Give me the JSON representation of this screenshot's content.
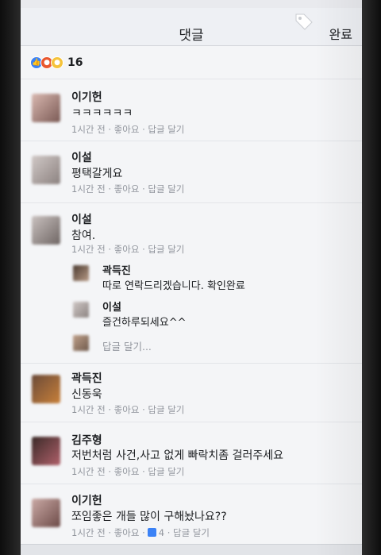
{
  "header": {
    "title": "댓글",
    "done_label": "완료"
  },
  "reactions": {
    "count": "16"
  },
  "comments": [
    {
      "name": "이기헌",
      "text": "ㅋㅋㅋㅋㅋㅋ",
      "meta": "1시간 전 · 좋아요 · 답글 달기"
    },
    {
      "name": "이설",
      "text": "평택갈게요",
      "meta": "1시간 전 · 좋아요 · 답글 달기"
    },
    {
      "name": "이설",
      "text": "참여.",
      "meta": "1시간 전 · 좋아요 · 답글 달기"
    },
    {
      "name": "곽득진",
      "text": "신동욱",
      "meta": "1시간 전 · 좋아요 · 답글 달기"
    },
    {
      "name": "김주형",
      "text": "저번처럼 사건,사고 없게 빠락치좀 걸러주세요",
      "meta": "1시간 전 · 좋아요 · 답글 달기"
    },
    {
      "name": "이기헌",
      "text": "쪼임좋은 개들 많이 구해놨나요??",
      "meta_prefix": "1시간 전 · 좋아요 ·",
      "meta_likes": "4",
      "meta_suffix": "· 답글 달기"
    }
  ],
  "replies": [
    {
      "name": "곽득진",
      "text": "따로 연락드리겠습니다. 확인완료"
    },
    {
      "name": "이설",
      "text": "즐건하루되세요^^"
    }
  ],
  "reply_link": "답글 달기..."
}
